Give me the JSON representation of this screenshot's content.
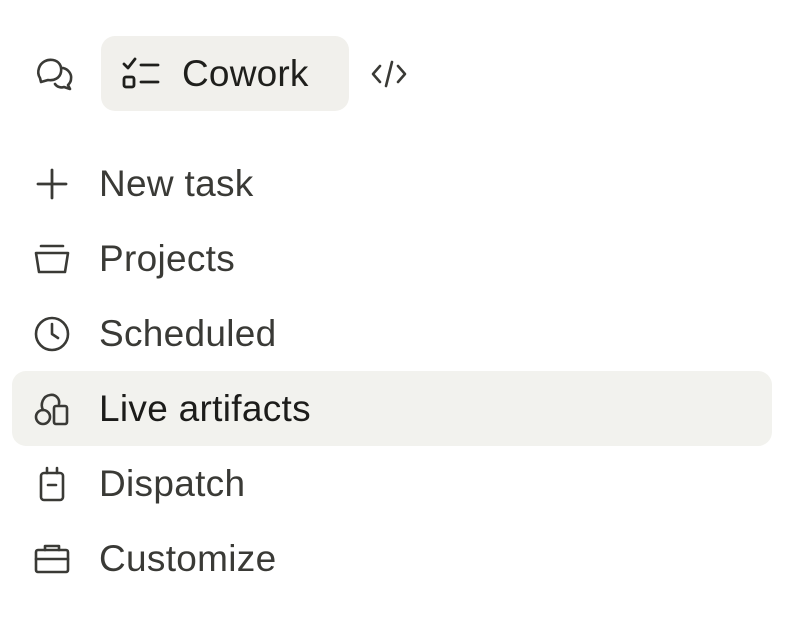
{
  "modes": {
    "chat_icon": "chat-bubbles-icon",
    "cowork_icon": "checklist-icon",
    "cowork_label": "Cowork",
    "code_icon": "code-brackets-icon",
    "active": "Cowork"
  },
  "nav": {
    "items": [
      {
        "label": "New task",
        "icon": "plus-icon",
        "active": false
      },
      {
        "label": "Projects",
        "icon": "folder-tray-icon",
        "active": false
      },
      {
        "label": "Scheduled",
        "icon": "clock-icon",
        "active": false
      },
      {
        "label": "Live artifacts",
        "icon": "shapes-icon",
        "active": true
      },
      {
        "label": "Dispatch",
        "icon": "device-icon",
        "active": false
      },
      {
        "label": "Customize",
        "icon": "briefcase-icon",
        "active": false
      }
    ]
  },
  "colors": {
    "active_bg": "#f2f2ee",
    "text": "#3a3a36",
    "text_active": "#1c1c1a"
  }
}
